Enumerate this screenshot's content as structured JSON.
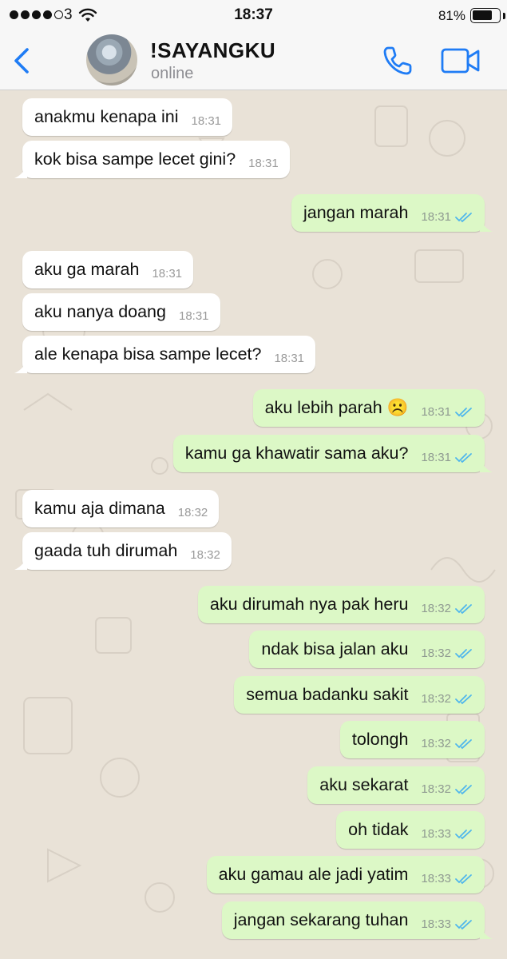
{
  "status_bar": {
    "carrier": "3",
    "time": "18:37",
    "battery_percent": "81%",
    "battery_level": 0.81
  },
  "header": {
    "contact_name": "!SAYANGKU",
    "contact_status": "online"
  },
  "icons": {
    "back": "chevron-left-icon",
    "call": "phone-icon",
    "video": "video-camera-icon",
    "read_receipt": "double-check-icon"
  },
  "colors": {
    "accent": "#1f7cf5",
    "incoming_bubble": "#ffffff",
    "outgoing_bubble": "#dcf8c6",
    "read_check": "#4fb6ec"
  },
  "messages": [
    {
      "direction": "in",
      "text": "anakmu kenapa ini",
      "time": "18:31",
      "tail": false
    },
    {
      "direction": "in",
      "text": "kok bisa sampe lecet gini?",
      "time": "18:31",
      "tail": true
    },
    {
      "direction": "out",
      "text": "jangan marah",
      "time": "18:31",
      "tail": true
    },
    {
      "direction": "in",
      "text": "aku ga marah",
      "time": "18:31",
      "tail": false
    },
    {
      "direction": "in",
      "text": "aku nanya doang",
      "time": "18:31",
      "tail": false
    },
    {
      "direction": "in",
      "text": "ale kenapa bisa sampe lecet?",
      "time": "18:31",
      "tail": true
    },
    {
      "direction": "out",
      "text": "aku lebih parah ☹️",
      "time": "18:31",
      "tail": false
    },
    {
      "direction": "out",
      "text": "kamu ga khawatir sama aku?",
      "time": "18:31",
      "tail": true
    },
    {
      "direction": "in",
      "text": "kamu aja dimana",
      "time": "18:32",
      "tail": false
    },
    {
      "direction": "in",
      "text": "gaada tuh dirumah",
      "time": "18:32",
      "tail": true
    },
    {
      "direction": "out",
      "text": "aku dirumah nya pak heru",
      "time": "18:32",
      "tail": false
    },
    {
      "direction": "out",
      "text": "ndak bisa jalan aku",
      "time": "18:32",
      "tail": false
    },
    {
      "direction": "out",
      "text": "semua badanku sakit",
      "time": "18:32",
      "tail": false
    },
    {
      "direction": "out",
      "text": "tolongh",
      "time": "18:32",
      "tail": false
    },
    {
      "direction": "out",
      "text": "aku sekarat",
      "time": "18:32",
      "tail": false
    },
    {
      "direction": "out",
      "text": "oh tidak",
      "time": "18:33",
      "tail": false
    },
    {
      "direction": "out",
      "text": "aku gamau ale jadi yatim",
      "time": "18:33",
      "tail": false
    },
    {
      "direction": "out",
      "text": "jangan sekarang tuhan",
      "time": "18:33",
      "tail": true
    }
  ]
}
